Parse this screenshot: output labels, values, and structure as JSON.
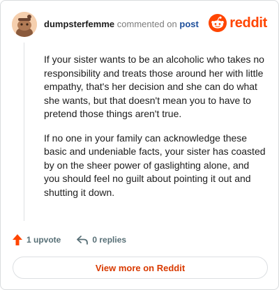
{
  "comment": {
    "username": "dumpsterfemme",
    "commented_text": "commented on",
    "post_link": "post",
    "paragraphs": [
      "If your sister wants to be an alcoholic who takes no responsibility and treats those around her with little empathy, that's her decision and she can do what she wants, but that doesn't mean you to have to pretend those things aren't true.",
      "If no one in your family can acknowledge these basic and undeniable facts, your sister has coasted by on the sheer power of gaslighting alone, and you should feel no guilt about pointing it out and shutting it down."
    ]
  },
  "logo": {
    "text": "reddit",
    "icon": "reddit-snoo-icon",
    "color": "#ff4500"
  },
  "actions": {
    "upvote_label": "1 upvote",
    "upvote_icon": "upvote-arrow-icon",
    "upvote_color": "#ff4500",
    "replies_label": "0 replies",
    "replies_icon": "reply-arrow-icon"
  },
  "footer": {
    "view_more_label": "View more on Reddit",
    "accent": "#d93a00"
  }
}
